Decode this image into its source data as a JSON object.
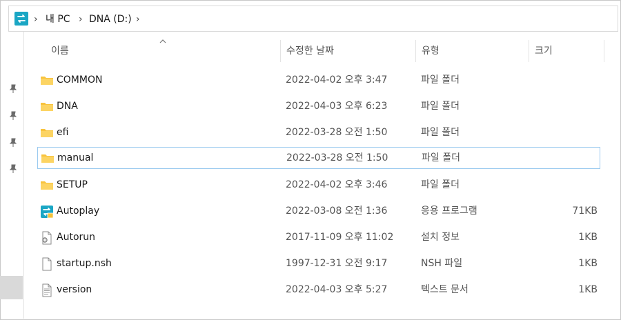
{
  "breadcrumb": {
    "app_icon": "dna-app-icon",
    "items": [
      "내 PC",
      "DNA (D:)"
    ]
  },
  "columns": {
    "name": "이름",
    "date": "수정한 날짜",
    "type": "유형",
    "size": "크기"
  },
  "files": [
    {
      "name": "COMMON",
      "date": "2022-04-02 오후 3:47",
      "type": "파일 폴더",
      "size": "",
      "icon": "folder-icon"
    },
    {
      "name": "DNA",
      "date": "2022-04-03 오후 6:23",
      "type": "파일 폴더",
      "size": "",
      "icon": "folder-icon"
    },
    {
      "name": "efi",
      "date": "2022-03-28 오전 1:50",
      "type": "파일 폴더",
      "size": "",
      "icon": "folder-icon"
    },
    {
      "name": "manual",
      "date": "2022-03-28 오전 1:50",
      "type": "파일 폴더",
      "size": "",
      "icon": "folder-icon",
      "selected": true
    },
    {
      "name": "SETUP",
      "date": "2022-04-02 오후 3:46",
      "type": "파일 폴더",
      "size": "",
      "icon": "folder-icon"
    },
    {
      "name": "Autoplay",
      "date": "2022-03-08 오전 1:36",
      "type": "응용 프로그램",
      "size": "71KB",
      "icon": "autoplay-app-icon"
    },
    {
      "name": "Autorun",
      "date": "2017-11-09 오후 11:02",
      "type": "설치 정보",
      "size": "1KB",
      "icon": "settings-file-icon"
    },
    {
      "name": "startup.nsh",
      "date": "1997-12-31 오전 9:17",
      "type": "NSH 파일",
      "size": "1KB",
      "icon": "blank-file-icon"
    },
    {
      "name": "version",
      "date": "2022-04-03 오후 5:27",
      "type": "텍스트 문서",
      "size": "1KB",
      "icon": "text-file-icon"
    }
  ],
  "colors": {
    "folder": "#f8c33d",
    "accent": "#1aa6c4",
    "selection_border": "#99c9ef"
  }
}
